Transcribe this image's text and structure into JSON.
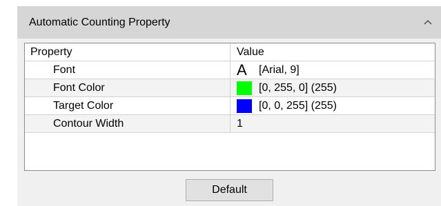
{
  "panel": {
    "title": "Automatic Counting Property",
    "collapse_icon": "chevron-up-icon"
  },
  "grid": {
    "columns": [
      "Property",
      "Value"
    ],
    "rows": [
      {
        "name": "Font",
        "value": "[Arial, 9]",
        "icon": "font-A-icon",
        "glyph": "A"
      },
      {
        "name": "Font Color",
        "value": "[0, 255, 0] (255)",
        "swatch": "#00ff00"
      },
      {
        "name": "Target Color",
        "value": "[0, 0, 255] (255)",
        "swatch": "#0000ff"
      },
      {
        "name": "Contour Width",
        "value": "1"
      }
    ]
  },
  "buttons": {
    "default_label": "Default"
  },
  "colors": {
    "header_bg": "#d6d6d6",
    "panel_bg": "#f0f0f0",
    "font_color_swatch": "#00ff00",
    "target_color_swatch": "#0000ff"
  }
}
